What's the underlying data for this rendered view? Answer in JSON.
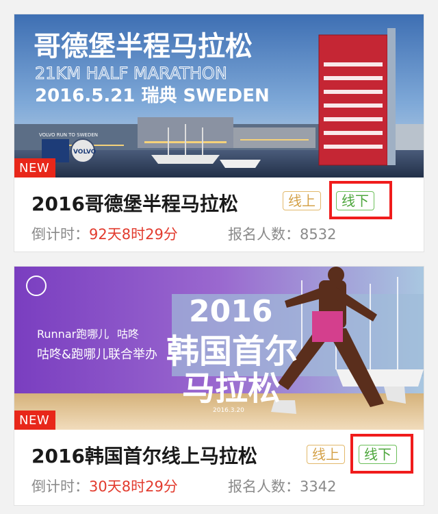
{
  "events": [
    {
      "banner": {
        "title_cn": "哥德堡半程马拉松",
        "title_en": "21KM HALF MARATHON",
        "date_line": "2016.5.21 瑞典 SWEDEN",
        "sponsor_text": "VOLVO RUN TO SWEDEN"
      },
      "badge": "NEW",
      "title": "2016哥德堡半程马拉松",
      "tag_online": "线上",
      "tag_offline": "线下",
      "countdown_label": "倒计时：",
      "countdown_value": "92天8时29分",
      "signup_label": "报名人数：",
      "signup_count": "8532"
    },
    {
      "banner": {
        "year": "2016",
        "title_line1": "韩国首尔",
        "title_line2": "马拉松",
        "date": "2016.3.20",
        "brand1": "Runnar跑哪儿",
        "brand2": "咕咚",
        "organizer": "咕咚&跑哪儿联合举办"
      },
      "badge": "NEW",
      "title": "2016韩国首尔线上马拉松",
      "tag_online": "线上",
      "tag_offline": "线下",
      "countdown_label": "倒计时：",
      "countdown_value": "30天8时29分",
      "signup_label": "报名人数：",
      "signup_count": "3342"
    }
  ],
  "colors": {
    "new_badge": "#e8271a",
    "countdown": "#e23b2e",
    "tag_online": "#d4a24a",
    "tag_offline": "#4da63c",
    "highlight": "#f01c1c"
  }
}
